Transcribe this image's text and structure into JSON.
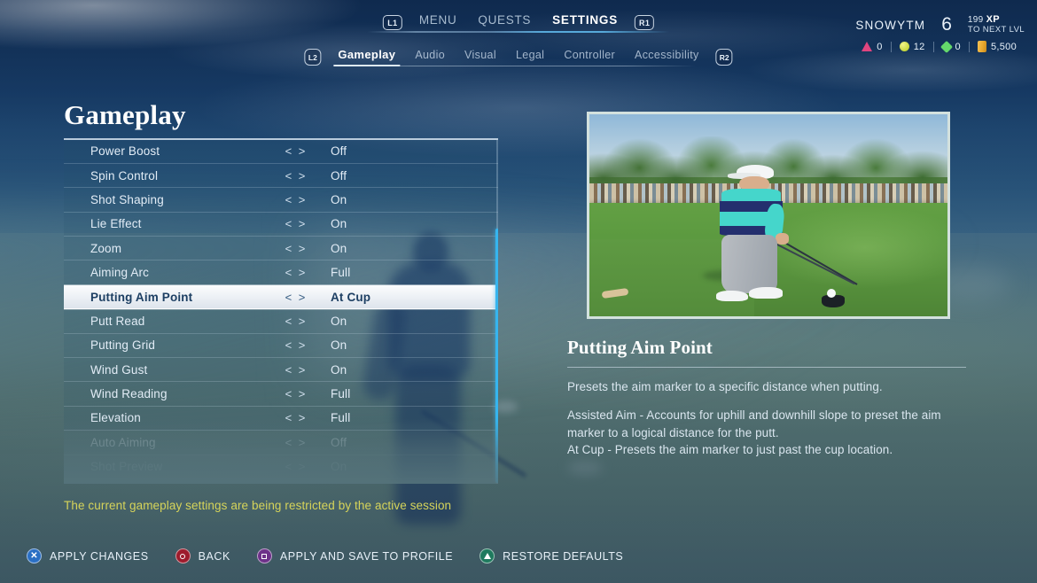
{
  "header": {
    "left_bumper": "L1",
    "right_bumper": "R1",
    "nav": [
      {
        "label": "MENU",
        "active": false
      },
      {
        "label": "QUESTS",
        "active": false
      },
      {
        "label": "SETTINGS",
        "active": true
      }
    ]
  },
  "player": {
    "name": "SNOWYTM",
    "level": "6",
    "xp_amount": "199",
    "xp_unit": "XP",
    "xp_sub": "TO NEXT LVL",
    "currencies": [
      {
        "icon": "triangle-currency-icon",
        "value": "0",
        "color": "#e0457f"
      },
      {
        "icon": "ball-currency-icon",
        "value": "12",
        "color": "#c8d83c"
      },
      {
        "icon": "gem-currency-icon",
        "value": "0",
        "color": "#64d86b"
      },
      {
        "icon": "coin-currency-icon",
        "value": "5,500",
        "color": "#e8a82f"
      }
    ]
  },
  "tabs": {
    "left_trigger": "L2",
    "right_trigger": "R2",
    "items": [
      {
        "label": "Gameplay",
        "active": true
      },
      {
        "label": "Audio",
        "active": false
      },
      {
        "label": "Visual",
        "active": false
      },
      {
        "label": "Legal",
        "active": false
      },
      {
        "label": "Controller",
        "active": false
      },
      {
        "label": "Accessibility",
        "active": false
      }
    ]
  },
  "settings": {
    "title": "Gameplay",
    "arrows": "< >",
    "options": [
      {
        "label": "Power Boost",
        "value": "Off",
        "selected": false,
        "fade": 0
      },
      {
        "label": "Spin Control",
        "value": "Off",
        "selected": false,
        "fade": 0
      },
      {
        "label": "Shot Shaping",
        "value": "On",
        "selected": false,
        "fade": 0
      },
      {
        "label": "Lie Effect",
        "value": "On",
        "selected": false,
        "fade": 0
      },
      {
        "label": "Zoom",
        "value": "On",
        "selected": false,
        "fade": 0
      },
      {
        "label": "Aiming Arc",
        "value": "Full",
        "selected": false,
        "fade": 0
      },
      {
        "label": "Putting Aim Point",
        "value": "At Cup",
        "selected": true,
        "fade": 0
      },
      {
        "label": "Putt Read",
        "value": "On",
        "selected": false,
        "fade": 0
      },
      {
        "label": "Putting Grid",
        "value": "On",
        "selected": false,
        "fade": 0
      },
      {
        "label": "Wind Gust",
        "value": "On",
        "selected": false,
        "fade": 0
      },
      {
        "label": "Wind Reading",
        "value": "Full",
        "selected": false,
        "fade": 0
      },
      {
        "label": "Elevation",
        "value": "Full",
        "selected": false,
        "fade": 0
      },
      {
        "label": "Auto Aiming",
        "value": "Off",
        "selected": false,
        "fade": 1
      },
      {
        "label": "Shot Preview",
        "value": "On",
        "selected": false,
        "fade": 2
      }
    ],
    "restriction_note": "The current gameplay settings are being restricted by the active session"
  },
  "detail": {
    "preview_alt": "golfer-at-address-preview",
    "title": "Putting Aim Point",
    "paragraphs": [
      "Presets the aim marker to a specific distance when putting.",
      "Assisted Aim - Accounts for uphill and downhill slope to preset the aim marker to a logical distance for the putt.",
      "At Cup - Presets the aim marker to just past the cup location."
    ]
  },
  "actions": [
    {
      "glyph": "cross-button-icon",
      "shape": "cross",
      "label": "APPLY CHANGES"
    },
    {
      "glyph": "circle-button-icon",
      "shape": "circle",
      "label": "BACK"
    },
    {
      "glyph": "square-button-icon",
      "shape": "square",
      "label": "APPLY AND SAVE TO PROFILE"
    },
    {
      "glyph": "triangle-button-icon",
      "shape": "triangle",
      "label": "RESTORE DEFAULTS"
    }
  ]
}
